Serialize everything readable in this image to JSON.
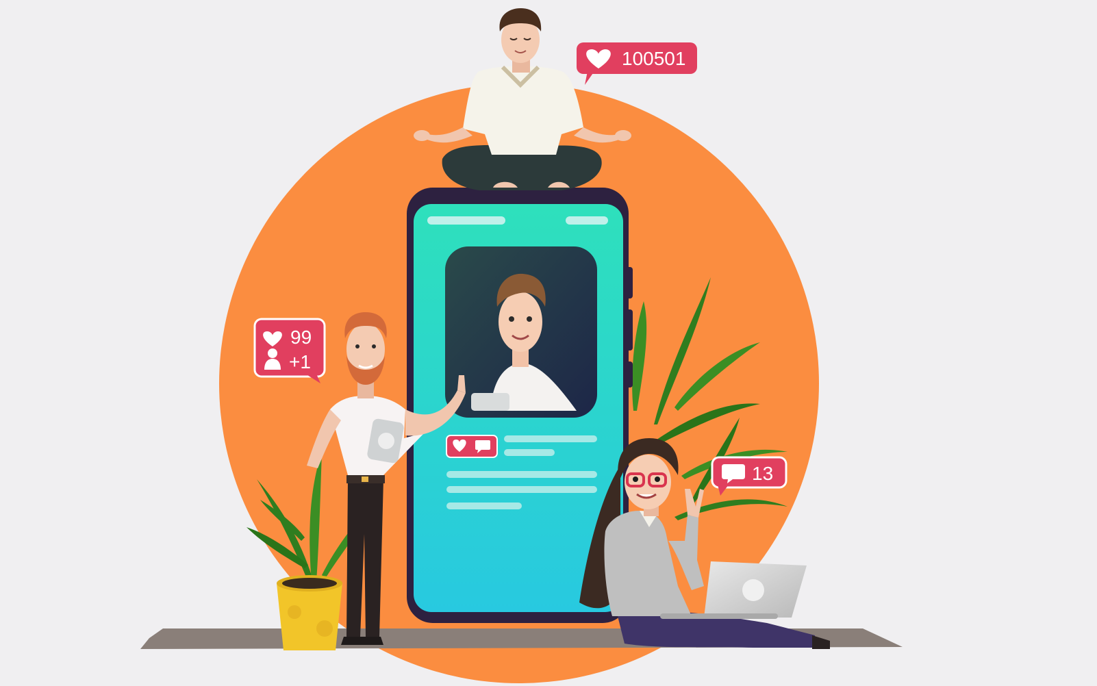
{
  "notifications": {
    "likes_top": {
      "icon": "heart-icon",
      "count": "100501"
    },
    "likes_left": {
      "icon": "heart-icon",
      "count": "99"
    },
    "followers_left": {
      "icon": "user-icon",
      "count": "+1"
    },
    "comments_right": {
      "icon": "comment-icon",
      "count": "13"
    }
  },
  "post_actions": {
    "like_icon": "heart-icon",
    "comment_icon": "comment-icon"
  },
  "colors": {
    "background": "#f0eff1",
    "sun": "#fb8d40",
    "phone_screen_top": "#2ee0bc",
    "phone_screen_bottom": "#28c9e0",
    "badge": "#e13f5f",
    "plant_pot": "#f2c529",
    "ground": "#8a7f79"
  }
}
